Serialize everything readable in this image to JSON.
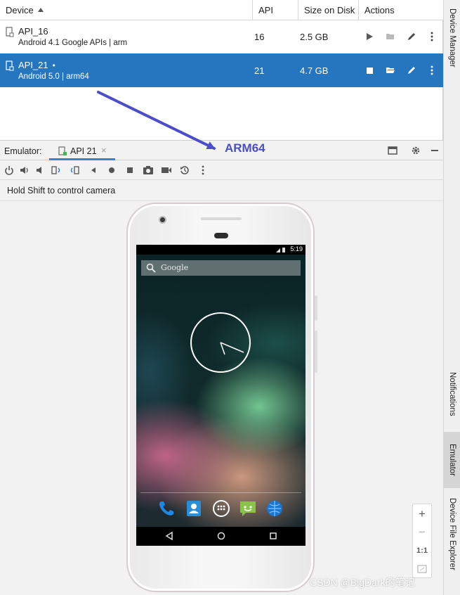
{
  "device_manager": {
    "columns": {
      "device": "Device",
      "api": "API",
      "size": "Size on Disk",
      "actions": "Actions"
    },
    "rows": [
      {
        "name": "API_16",
        "subtitle": "Android 4.1 Google APIs | arm",
        "api": "16",
        "size": "2.5 GB",
        "selected": false,
        "running": false
      },
      {
        "name": "API_21",
        "running_marker": "•",
        "subtitle": "Android 5.0 | arm64",
        "api": "21",
        "size": "4.7 GB",
        "selected": true,
        "running": true
      }
    ]
  },
  "emulator": {
    "label": "Emulator:",
    "tab_label": "API 21",
    "tab_close": "×",
    "hint": "Hold Shift to control camera",
    "toolbar_icons": [
      "power-icon",
      "volume-up-icon",
      "volume-down-icon",
      "rotate-left-icon",
      "rotate-right-icon",
      "back-icon",
      "home-icon",
      "overview-icon",
      "screenshot-icon",
      "screen-record-icon",
      "snapshot-icon",
      "more-icon"
    ],
    "zoom": {
      "plus": "+",
      "minus": "−",
      "one_to_one": "1:1"
    }
  },
  "phone_screen": {
    "status_time": "5:19",
    "search_text": "Google",
    "dock_icons": [
      "phone-icon",
      "contacts-icon",
      "app-drawer-icon",
      "messaging-icon",
      "browser-icon"
    ],
    "nav_icons": [
      "nav-back-icon",
      "nav-home-icon",
      "nav-recents-icon"
    ]
  },
  "tool_strip": {
    "tabs": [
      "Device Manager",
      "Notifications",
      "Emulator",
      "Device File Explorer"
    ],
    "active": "Emulator"
  },
  "annotation": {
    "text": "ARM64",
    "color": "#4a4fc7"
  },
  "watermark": "CSDN @BigDark的笔记",
  "colors": {
    "selection": "#2675bf",
    "tab_underline": "#3d7fd0"
  }
}
